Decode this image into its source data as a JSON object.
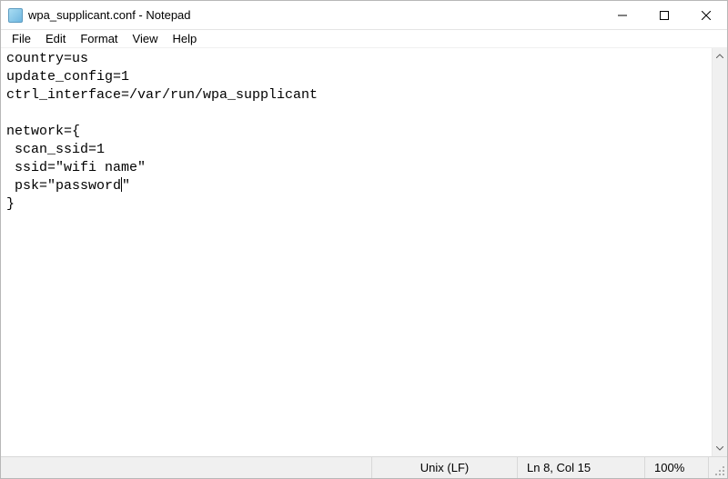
{
  "window": {
    "title": "wpa_supplicant.conf - Notepad"
  },
  "menu": {
    "file": "File",
    "edit": "Edit",
    "format": "Format",
    "view": "View",
    "help": "Help"
  },
  "document": {
    "lines": [
      "country=us",
      "update_config=1",
      "ctrl_interface=/var/run/wpa_supplicant",
      "",
      "network={",
      " scan_ssid=1",
      " ssid=\"wifi name\"",
      " psk=\"password\"",
      "}"
    ],
    "caret_line_index": 7,
    "caret_before": " psk=\"password",
    "caret_after": "\""
  },
  "status": {
    "encoding": "Unix (LF)",
    "position": "Ln 8, Col 15",
    "zoom": "100%"
  }
}
